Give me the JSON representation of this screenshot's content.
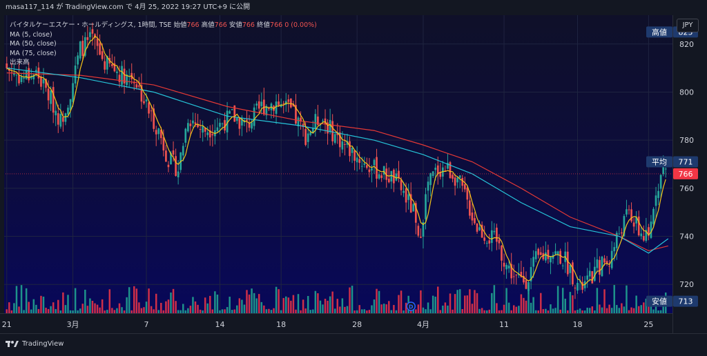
{
  "header": {
    "text": "masa117_114 が TradingView.com で 4月 25, 2022 19:27 UTC+9 に公開"
  },
  "legend": {
    "symbol": "バイタルケーエスケー・ホールディングス, 1時間, TSE",
    "open_label": "始値",
    "open": "766",
    "high_label": "高値",
    "high": "766",
    "low_label": "安値",
    "low": "766",
    "close_label": "終値",
    "close": "766",
    "change": "0 (0.00%)",
    "ma_lines": [
      "MA (5, close)",
      "MA (50, close)",
      "MA (75, close)"
    ],
    "volume_label": "出来高"
  },
  "currency": "JPY",
  "footer": {
    "logo_text": "TradingView"
  },
  "colors": {
    "up": "#26a69a",
    "down": "#ef5350",
    "ma5": "#f5c518",
    "ma50": "#26c6da",
    "ma75": "#e53935",
    "vol_up": "#22ab94",
    "vol_down": "#f23645"
  },
  "chart_data": {
    "type": "candlestick",
    "title": "バイタルケーエスケー・ホールディングス, 1時間, TSE",
    "ylim": [
      708,
      832
    ],
    "y_ticks": [
      720,
      740,
      760,
      780,
      800,
      820
    ],
    "x_tick_labels": [
      "21",
      "3月",
      "7",
      "14",
      "18",
      "28",
      "4月",
      "11",
      "18",
      "25"
    ],
    "x_tick_index": [
      0,
      27,
      57,
      87,
      112,
      143,
      170,
      203,
      233,
      262
    ],
    "bar_count": 270,
    "price_labels": [
      {
        "label": "高値",
        "value": "825",
        "price": 825,
        "color": "#1e3a6e"
      },
      {
        "label": "平均",
        "value": "771",
        "price": 771,
        "color": "#1e3a6e"
      },
      {
        "label": "",
        "value": "766",
        "price": 766,
        "color": "#f23645"
      },
      {
        "label": "安値",
        "value": "713",
        "price": 713,
        "color": "#1e3a6e"
      }
    ],
    "series": [
      {
        "name": "MA (5, close)",
        "kind": "ma5"
      },
      {
        "name": "MA (50, close)",
        "kind": "ma50"
      },
      {
        "name": "MA (75, close)",
        "kind": "ma75"
      },
      {
        "name": "出来高",
        "kind": "volume"
      }
    ],
    "close_path": [
      [
        0,
        810
      ],
      [
        6,
        806
      ],
      [
        12,
        808
      ],
      [
        18,
        797
      ],
      [
        22,
        788
      ],
      [
        26,
        800
      ],
      [
        30,
        818
      ],
      [
        35,
        822
      ],
      [
        40,
        812
      ],
      [
        46,
        808
      ],
      [
        52,
        806
      ],
      [
        58,
        792
      ],
      [
        62,
        784
      ],
      [
        66,
        772
      ],
      [
        70,
        768
      ],
      [
        74,
        790
      ],
      [
        80,
        784
      ],
      [
        86,
        786
      ],
      [
        92,
        790
      ],
      [
        98,
        786
      ],
      [
        104,
        794
      ],
      [
        110,
        796
      ],
      [
        116,
        792
      ],
      [
        122,
        782
      ],
      [
        128,
        790
      ],
      [
        134,
        782
      ],
      [
        140,
        776
      ],
      [
        146,
        770
      ],
      [
        152,
        767
      ],
      [
        158,
        764
      ],
      [
        162,
        758
      ],
      [
        166,
        750
      ],
      [
        168,
        737
      ],
      [
        172,
        762
      ],
      [
        176,
        768
      ],
      [
        180,
        768
      ],
      [
        184,
        764
      ],
      [
        188,
        754
      ],
      [
        192,
        744
      ],
      [
        196,
        740
      ],
      [
        200,
        738
      ],
      [
        204,
        728
      ],
      [
        208,
        722
      ],
      [
        212,
        722
      ],
      [
        216,
        730
      ],
      [
        222,
        734
      ],
      [
        228,
        730
      ],
      [
        234,
        718
      ],
      [
        238,
        722
      ],
      [
        242,
        728
      ],
      [
        246,
        730
      ],
      [
        250,
        742
      ],
      [
        254,
        750
      ],
      [
        258,
        742
      ],
      [
        262,
        738
      ],
      [
        265,
        760
      ],
      [
        268,
        768
      ],
      [
        270,
        766
      ]
    ],
    "ma50_path": [
      [
        0,
        810
      ],
      [
        30,
        806
      ],
      [
        60,
        800
      ],
      [
        90,
        790
      ],
      [
        120,
        786
      ],
      [
        150,
        780
      ],
      [
        170,
        774
      ],
      [
        190,
        766
      ],
      [
        210,
        754
      ],
      [
        230,
        744
      ],
      [
        250,
        740
      ],
      [
        262,
        733
      ],
      [
        270,
        739
      ]
    ],
    "ma75_path": [
      [
        0,
        808
      ],
      [
        30,
        807
      ],
      [
        60,
        803
      ],
      [
        90,
        794
      ],
      [
        120,
        788
      ],
      [
        150,
        784
      ],
      [
        170,
        778
      ],
      [
        190,
        771
      ],
      [
        210,
        760
      ],
      [
        230,
        748
      ],
      [
        250,
        740
      ],
      [
        262,
        734
      ],
      [
        270,
        736
      ]
    ]
  }
}
